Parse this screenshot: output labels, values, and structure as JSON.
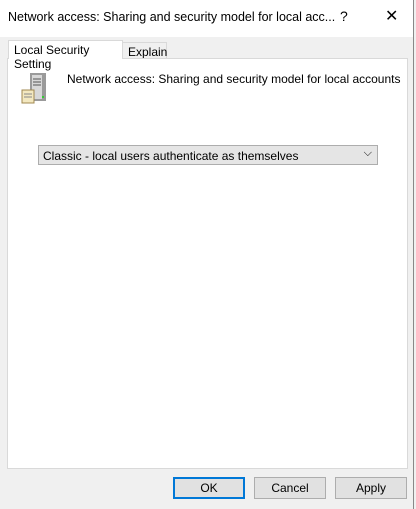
{
  "window": {
    "title": "Network access: Sharing and security model for local acc...",
    "help": "?",
    "close": "✕"
  },
  "tabs": [
    {
      "label": "Local Security Setting"
    },
    {
      "label": "Explain"
    }
  ],
  "policy": {
    "name": "Network access: Sharing and security model for local accounts",
    "icon": "server-policy-icon"
  },
  "dropdown": {
    "value": "Classic - local users authenticate as themselves",
    "chevron": "⌵"
  },
  "buttons": {
    "ok": "OK",
    "cancel": "Cancel",
    "apply": "Apply"
  }
}
